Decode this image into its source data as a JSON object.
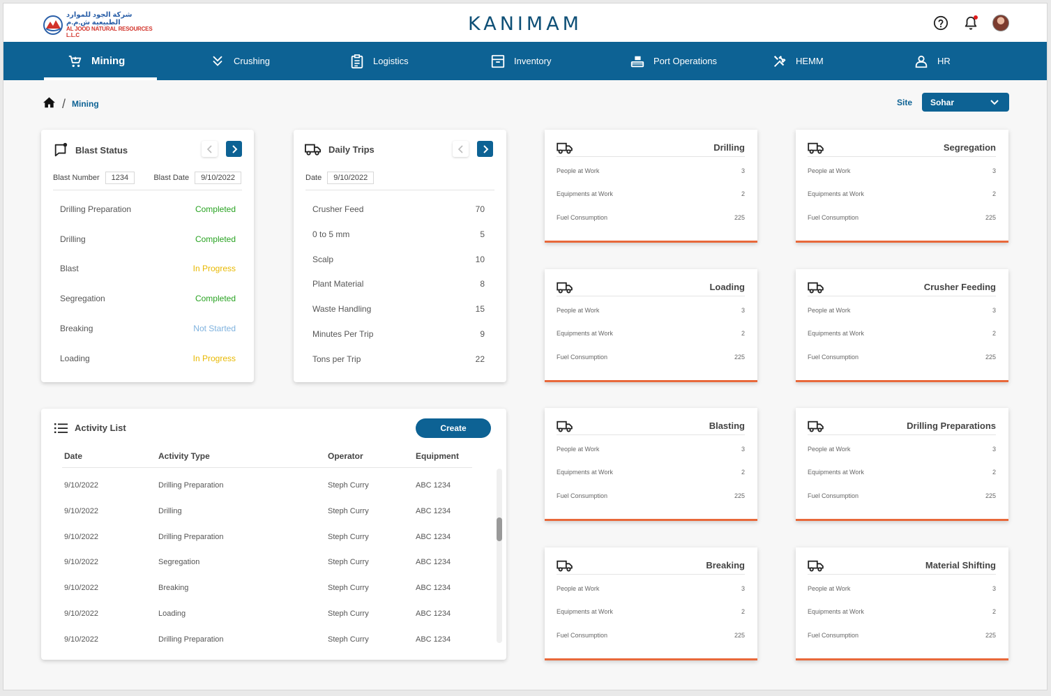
{
  "header": {
    "logo_ar": "شركة الجود للموارد الطبيعية ش.م.م",
    "logo_en": "AL JOOD NATURAL RESOURCES L.L.C",
    "brand": "KANIMAM"
  },
  "icons": {
    "help": "help-circle-icon",
    "notifications": "bell-icon",
    "home": "home-icon",
    "truck": "truck-icon"
  },
  "colors": {
    "primary": "#0d6294",
    "accent": "#e8683a",
    "completed": "#29a322",
    "in_progress": "#e8b800",
    "not_started": "#7fb2de"
  },
  "nav": [
    {
      "label": "Mining",
      "icon": "cart-icon",
      "active": true
    },
    {
      "label": "Crushing",
      "icon": "double-chevron-down-icon"
    },
    {
      "label": "Logistics",
      "icon": "clipboard-icon"
    },
    {
      "label": "Inventory",
      "icon": "archive-box-icon"
    },
    {
      "label": "Port Operations",
      "icon": "conveyor-icon"
    },
    {
      "label": "HEMM",
      "icon": "tools-icon"
    },
    {
      "label": "HR",
      "icon": "person-icon"
    }
  ],
  "breadcrumb": {
    "current": "Mining"
  },
  "site": {
    "label": "Site",
    "value": "Sohar"
  },
  "blast_status": {
    "title": "Blast Status",
    "blast_number_label": "Blast Number",
    "blast_number": "1234",
    "blast_date_label": "Blast Date",
    "blast_date": "9/10/2022",
    "items": [
      {
        "label": "Drilling Preparation",
        "status": "Completed",
        "kind": "completed"
      },
      {
        "label": "Drilling",
        "status": "Completed",
        "kind": "completed"
      },
      {
        "label": "Blast",
        "status": "In Progress",
        "kind": "progress"
      },
      {
        "label": "Segregation",
        "status": "Completed",
        "kind": "completed"
      },
      {
        "label": "Breaking",
        "status": "Not Started",
        "kind": "notstarted"
      },
      {
        "label": "Loading",
        "status": "In Progress",
        "kind": "progress"
      }
    ]
  },
  "daily_trips": {
    "title": "Daily Trips",
    "date_label": "Date",
    "date": "9/10/2022",
    "items": [
      {
        "label": "Crusher Feed",
        "value": "70"
      },
      {
        "label": "0 to 5 mm",
        "value": "5"
      },
      {
        "label": "Scalp",
        "value": "10"
      },
      {
        "label": "Plant Material",
        "value": "8"
      },
      {
        "label": "Waste Handling",
        "value": "15"
      },
      {
        "label": "Minutes Per Trip",
        "value": "9"
      },
      {
        "label": "Tons per Trip",
        "value": "22"
      }
    ]
  },
  "site_cards": [
    {
      "title": "Drilling",
      "people_label": "People at Work",
      "people": "3",
      "equip_label": "Equipments at Work",
      "equip": "2",
      "fuel_label": "Fuel Consumption",
      "fuel": "225"
    },
    {
      "title": "Segregation",
      "people_label": "People at Work",
      "people": "3",
      "equip_label": "Equipments at Work",
      "equip": "2",
      "fuel_label": "Fuel Consumption",
      "fuel": "225"
    },
    {
      "title": "Loading",
      "people_label": "People at Work",
      "people": "3",
      "equip_label": "Equipments at Work",
      "equip": "2",
      "fuel_label": "Fuel Consumption",
      "fuel": "225"
    },
    {
      "title": "Crusher Feeding",
      "people_label": "People at Work",
      "people": "3",
      "equip_label": "Equipments at Work",
      "equip": "2",
      "fuel_label": "Fuel Consumption",
      "fuel": "225"
    },
    {
      "title": "Blasting",
      "people_label": "People at Work",
      "people": "3",
      "equip_label": "Equipments at Work",
      "equip": "2",
      "fuel_label": "Fuel Consumption",
      "fuel": "225"
    },
    {
      "title": "Drilling Preparations",
      "people_label": "People at Work",
      "people": "3",
      "equip_label": "Equipments at Work",
      "equip": "2",
      "fuel_label": "Fuel Consumption",
      "fuel": "225"
    },
    {
      "title": "Breaking",
      "people_label": "People at Work",
      "people": "3",
      "equip_label": "Equipments at Work",
      "equip": "2",
      "fuel_label": "Fuel Consumption",
      "fuel": "225"
    },
    {
      "title": "Material Shifting",
      "people_label": "People at Work",
      "people": "3",
      "equip_label": "Equipments at Work",
      "equip": "2",
      "fuel_label": "Fuel Consumption",
      "fuel": "225"
    }
  ],
  "activity": {
    "title": "Activity List",
    "create_label": "Create",
    "columns": [
      "Date",
      "Activity Type",
      "Operator",
      "Equipment"
    ],
    "rows": [
      [
        "9/10/2022",
        "Drilling Preparation",
        "Steph Curry",
        "ABC 1234"
      ],
      [
        "9/10/2022",
        "Drilling",
        "Steph Curry",
        "ABC 1234"
      ],
      [
        "9/10/2022",
        "Drilling Preparation",
        "Steph Curry",
        "ABC 1234"
      ],
      [
        "9/10/2022",
        "Segregation",
        "Steph Curry",
        "ABC 1234"
      ],
      [
        "9/10/2022",
        "Breaking",
        "Steph Curry",
        "ABC 1234"
      ],
      [
        "9/10/2022",
        "Loading",
        "Steph Curry",
        "ABC 1234"
      ],
      [
        "9/10/2022",
        "Drilling Preparation",
        "Steph Curry",
        "ABC 1234"
      ]
    ]
  }
}
